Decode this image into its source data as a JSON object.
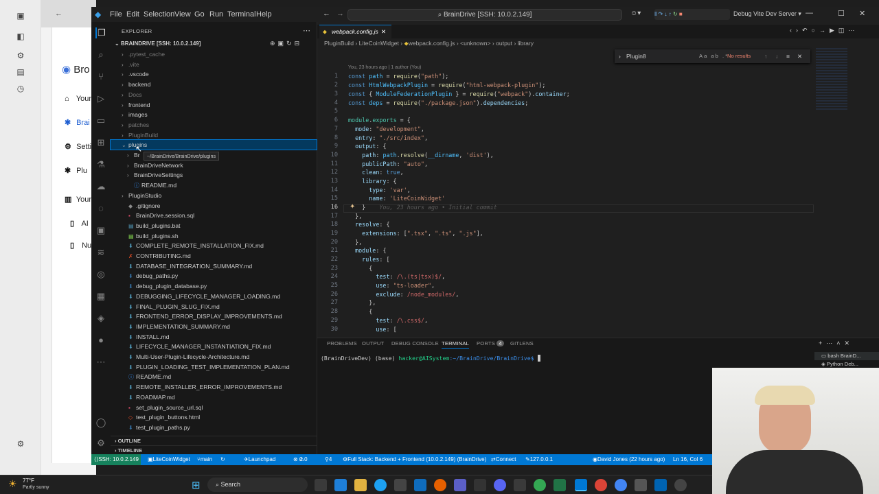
{
  "browser": {
    "logo_text": "Bro",
    "items": [
      {
        "icon": "home-icon",
        "label": "Your"
      },
      {
        "icon": "puzzle-icon",
        "label": "Brai"
      },
      {
        "icon": "gear-icon",
        "label": "Setti"
      },
      {
        "icon": "puzzle-icon",
        "label": "Plu"
      },
      {
        "icon": "book-icon",
        "label": "Your"
      },
      {
        "icon": "doc-icon",
        "label": "AI"
      },
      {
        "icon": "doc-icon",
        "label": "Nu"
      }
    ]
  },
  "titlebar": {
    "menus": [
      "File",
      "Edit",
      "Selection",
      "View",
      "Go",
      "Run",
      "Terminal",
      "Help"
    ],
    "command_center": "BrainDrive [SSH: 10.0.2.149]",
    "debug_config": "Debug Vite Dev Server"
  },
  "explorer": {
    "header": "EXPLORER",
    "root": "BRAINDRIVE [SSH: 10.0.2.149]",
    "tooltip": "~/BrainDrive/BrainDrive/plugins",
    "items": [
      {
        "label": ".pytest_cache",
        "type": "folder",
        "dim": true,
        "level": 0
      },
      {
        "label": ".vite",
        "type": "folder",
        "dim": true,
        "level": 0
      },
      {
        "label": ".vscode",
        "type": "folder",
        "dim": false,
        "level": 0
      },
      {
        "label": "backend",
        "type": "folder",
        "dim": false,
        "level": 0
      },
      {
        "label": "Docs",
        "type": "folder",
        "dim": true,
        "level": 0
      },
      {
        "label": "frontend",
        "type": "folder",
        "dim": false,
        "level": 0
      },
      {
        "label": "images",
        "type": "folder",
        "dim": false,
        "level": 0
      },
      {
        "label": "patches",
        "type": "folder",
        "dim": true,
        "level": 0
      },
      {
        "label": "PluginBuild",
        "type": "folder",
        "dim": true,
        "level": 0
      },
      {
        "label": "plugins",
        "type": "folder-open",
        "dim": false,
        "level": 0
      },
      {
        "label": "Br",
        "type": "folder",
        "dim": false,
        "level": 1
      },
      {
        "label": "BrainDriveNetwork",
        "type": "folder",
        "dim": false,
        "level": 1
      },
      {
        "label": "BrainDriveSettings",
        "type": "folder",
        "dim": false,
        "level": 1
      },
      {
        "label": "README.md",
        "type": "info",
        "dim": false,
        "level": 1
      },
      {
        "label": "PluginStudio",
        "type": "folder",
        "dim": false,
        "level": 0
      },
      {
        "label": ".gitignore",
        "type": "git",
        "dim": false,
        "level": 0
      },
      {
        "label": "BrainDrive.session.sql",
        "type": "sql",
        "dim": false,
        "level": 0
      },
      {
        "label": "build_plugins.bat",
        "type": "bat",
        "dim": false,
        "level": 0
      },
      {
        "label": "build_plugins.sh",
        "type": "sh",
        "dim": false,
        "level": 0
      },
      {
        "label": "COMPLETE_REMOTE_INSTALLATION_FIX.md",
        "type": "md",
        "dim": false,
        "level": 0
      },
      {
        "label": "CONTRIBUTING.md",
        "type": "mdx",
        "dim": false,
        "level": 0
      },
      {
        "label": "DATABASE_INTEGRATION_SUMMARY.md",
        "type": "md",
        "dim": false,
        "level": 0
      },
      {
        "label": "debug_paths.py",
        "type": "py",
        "dim": false,
        "level": 0
      },
      {
        "label": "debug_plugin_database.py",
        "type": "py",
        "dim": false,
        "level": 0
      },
      {
        "label": "DEBUGGING_LIFECYCLE_MANAGER_LOADING.md",
        "type": "md",
        "dim": false,
        "level": 0
      },
      {
        "label": "FINAL_PLUGIN_SLUG_FIX.md",
        "type": "md",
        "dim": false,
        "level": 0
      },
      {
        "label": "FRONTEND_ERROR_DISPLAY_IMPROVEMENTS.md",
        "type": "md",
        "dim": false,
        "level": 0
      },
      {
        "label": "IMPLEMENTATION_SUMMARY.md",
        "type": "md",
        "dim": false,
        "level": 0
      },
      {
        "label": "INSTALL.md",
        "type": "md",
        "dim": false,
        "level": 0
      },
      {
        "label": "LIFECYCLE_MANAGER_INSTANTIATION_FIX.md",
        "type": "md",
        "dim": false,
        "level": 0
      },
      {
        "label": "Multi-User-Plugin-Lifecycle-Architecture.md",
        "type": "md",
        "dim": false,
        "level": 0
      },
      {
        "label": "PLUGIN_LOADING_TEST_IMPLEMENTATION_PLAN.md",
        "type": "md",
        "dim": false,
        "level": 0
      },
      {
        "label": "README.md",
        "type": "info",
        "dim": false,
        "level": 0
      },
      {
        "label": "REMOTE_INSTALLER_ERROR_IMPROVEMENTS.md",
        "type": "md",
        "dim": false,
        "level": 0
      },
      {
        "label": "ROADMAP.md",
        "type": "md",
        "dim": false,
        "level": 0
      },
      {
        "label": "set_plugin_source_url.sql",
        "type": "sql",
        "dim": false,
        "level": 0
      },
      {
        "label": "test_plugin_buttons.html",
        "type": "html",
        "dim": false,
        "level": 0
      },
      {
        "label": "test_plugin_paths.py",
        "type": "py",
        "dim": false,
        "level": 0
      }
    ],
    "outline": "OUTLINE",
    "timeline": "TIMELINE"
  },
  "editor": {
    "tab": "webpack.config.js",
    "breadcrumbs": [
      "PluginBuild",
      "LiteCoinWidget",
      "webpack.config.js",
      "<unknown>",
      "output",
      "library"
    ],
    "blame_header": "You, 23 hours ago | 1 author (You)",
    "find_query": "Plugin8",
    "find_result": "No results",
    "ghost_blame": "You, 23 hours ago • Initial commit",
    "line_numbers": [
      "1",
      "2",
      "3",
      "4",
      "5",
      "6",
      "7",
      "8",
      "9",
      "10",
      "11",
      "12",
      "13",
      "14",
      "15",
      "16",
      "17",
      "18",
      "19",
      "20",
      "21",
      "22",
      "23",
      "24",
      "25",
      "26",
      "27",
      "28",
      "29",
      "30"
    ],
    "current_line": "16"
  },
  "panel": {
    "tabs": [
      "PROBLEMS",
      "OUTPUT",
      "DEBUG CONSOLE",
      "TERMINAL",
      "PORTS",
      "GITLENS"
    ],
    "ports_badge": "4",
    "prompt_env": "(BrainDriveDev) (base)",
    "prompt_user": "hacker@AISystem",
    "prompt_path": ":~/BrainDrive/BrainDrive$",
    "terminal_list": [
      "bash BrainD...",
      "Python Deb..."
    ]
  },
  "statusbar": {
    "remote": "SSH: 10.0.2.149",
    "branch_widget": "LiteCoinWidget",
    "git_branch": "main",
    "launchpad": "Launchpad",
    "errors": "0",
    "warnings": "0",
    "ports": "4",
    "run_config": "Full Stack: Backend + Frontend (10.0.2.149) (BrainDrive)",
    "connect": "Connect",
    "host": "127.0.0.1",
    "blame": "David Jones (22 hours ago)",
    "cursor": "Ln 16, Col 6"
  },
  "taskbar": {
    "weather_temp": "77°F",
    "weather_desc": "Partly sunny",
    "search": "Search"
  },
  "colors": {
    "accent": "#0078d4",
    "editor_bg": "#1f1f1f",
    "sidebar_bg": "#181818"
  }
}
